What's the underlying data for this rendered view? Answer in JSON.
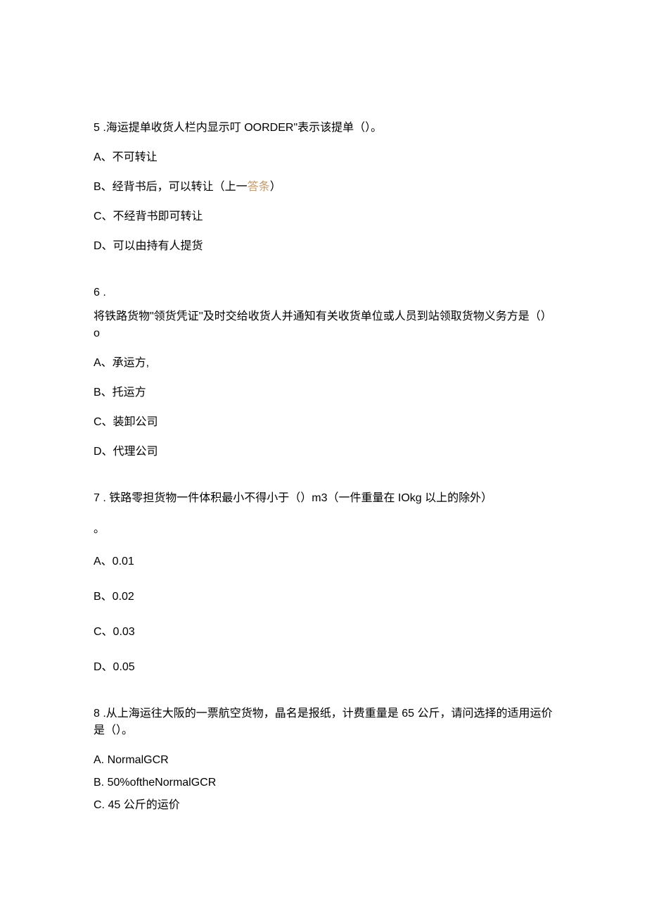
{
  "q5": {
    "stem": "5  .海运提单收货人栏内显示叮 OORDER\"表示该提单（）。",
    "A": "A、不可转让",
    "B_prefix": "B、经背书后，可以转让（上一",
    "B_link": "答条",
    "B_suffix": "）",
    "C": "C、不经背书即可转让",
    "D": "D、可以由持有人提货"
  },
  "q6": {
    "num": "6  .",
    "stem": "将铁路货物\"领货凭证''及时交给收货人并通知有关收货单位或人员到站领取货物义务方是（）o",
    "A": "A、承运方,",
    "B": "B、托运方",
    "C": "C、装卸公司",
    "D": "D、代理公司"
  },
  "q7": {
    "stem1": "7  . 铁路零担货物一件体积最小不得小于（）m3（一件重量在 IOkg 以上的除外）",
    "stem2": "。",
    "A": "A、0.01",
    "B": "B、0.02",
    "C": "C、0.03",
    "D": "D、0.05"
  },
  "q8": {
    "stem": "8  .从上海运往大阪的一票航空货物，晶名是报纸，计费重量是 65 公斤，请问选择的适用运价是（）。",
    "A": "A.   NormalGCR",
    "B": "B.   50%oftheNormalGCR",
    "C": "C.   45 公斤的运价"
  }
}
